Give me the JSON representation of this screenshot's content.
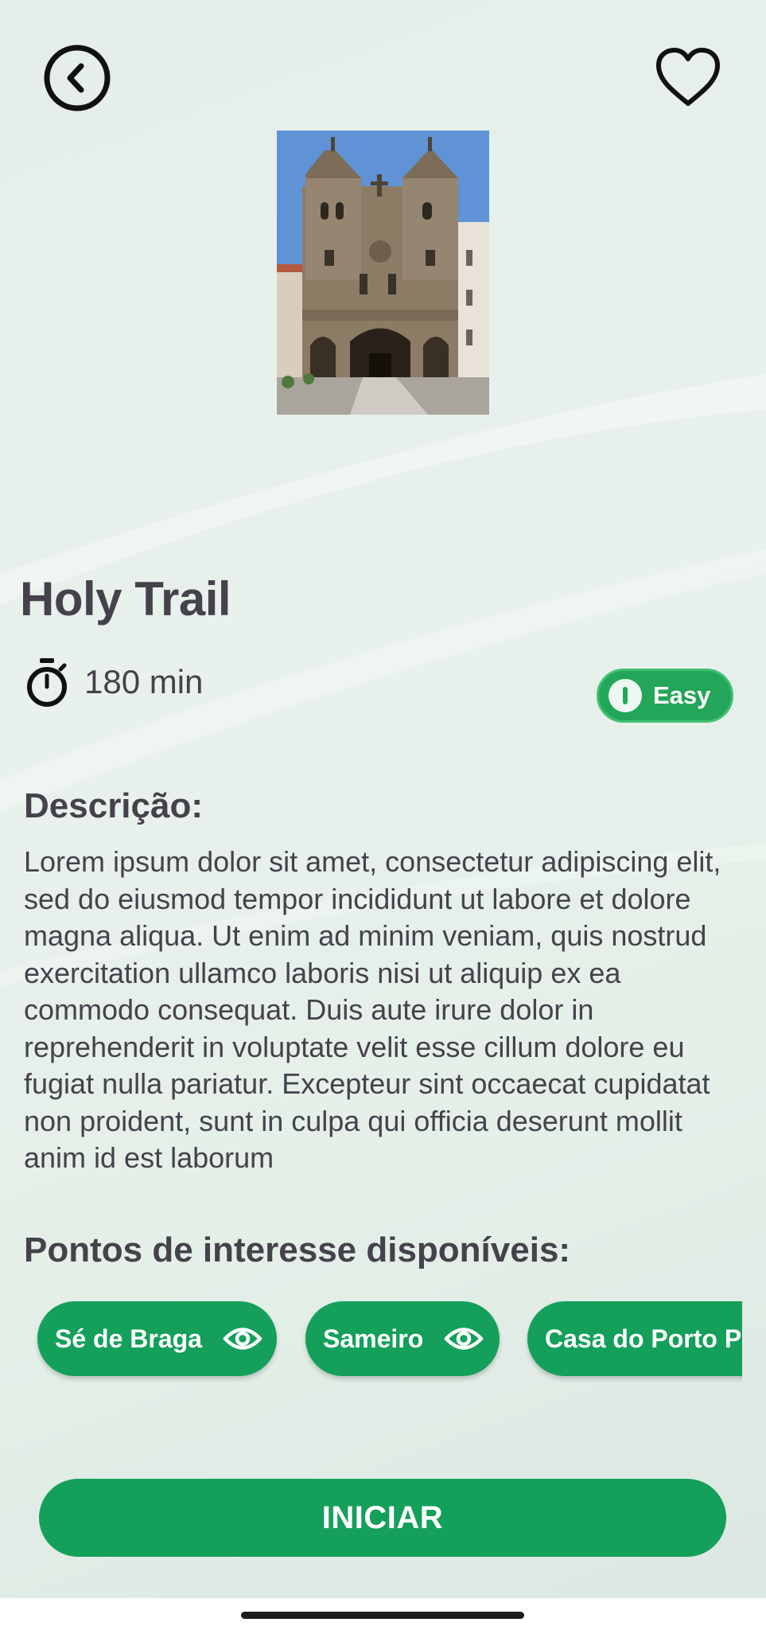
{
  "header": {
    "back_icon": "chevron-left-circle-icon",
    "favorite_icon": "heart-outline-icon"
  },
  "trail": {
    "title": "Holy Trail",
    "duration": "180 min",
    "duration_icon": "stopwatch-icon",
    "difficulty": "Easy",
    "difficulty_icon": "toggle-icon"
  },
  "description": {
    "heading": "Descrição:",
    "body": "Lorem ipsum dolor sit amet, consectetur adipiscing elit, sed do eiusmod tempor incididunt ut labore et dolore magna aliqua. Ut enim ad minim veniam, quis nostrud exercitation ullamco laboris nisi ut aliquip ex ea commodo consequat. Duis aute irure dolor in reprehenderit in voluptate velit esse cillum dolore eu fugiat nulla pariatur. Excepteur sint occaecat cupidatat non proident, sunt in culpa qui officia deserunt mollit anim id est laborum"
  },
  "points_of_interest": {
    "heading": "Pontos de interesse disponíveis:",
    "items": [
      {
        "label": "Sé de Braga",
        "icon": "eye-icon"
      },
      {
        "label": "Sameiro",
        "icon": "eye-icon"
      },
      {
        "label": "Casa do Porto P",
        "icon": "eye-icon"
      }
    ]
  },
  "actions": {
    "start_label": "INICIAR"
  },
  "colors": {
    "accent": "#14a05a",
    "badge": "#23a659",
    "text": "#45424c",
    "background": "#e6eeea"
  }
}
